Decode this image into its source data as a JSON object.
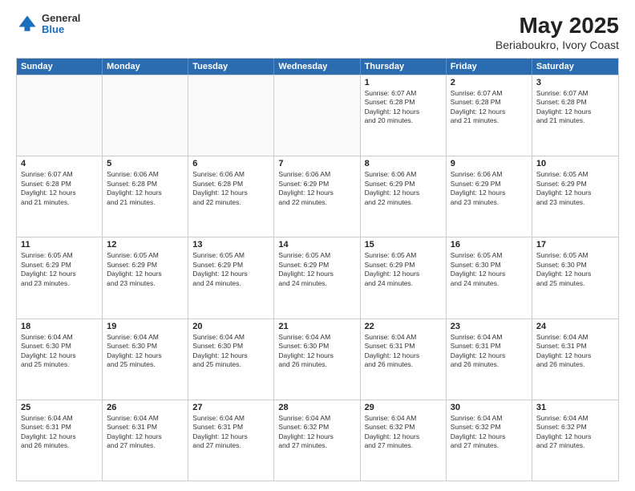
{
  "header": {
    "logo_line1": "General",
    "logo_line2": "Blue",
    "title": "May 2025",
    "subtitle": "Beriaboukro, Ivory Coast"
  },
  "weekdays": [
    "Sunday",
    "Monday",
    "Tuesday",
    "Wednesday",
    "Thursday",
    "Friday",
    "Saturday"
  ],
  "rows": [
    [
      {
        "day": "",
        "text": "",
        "empty": true
      },
      {
        "day": "",
        "text": "",
        "empty": true
      },
      {
        "day": "",
        "text": "",
        "empty": true
      },
      {
        "day": "",
        "text": "",
        "empty": true
      },
      {
        "day": "1",
        "text": "Sunrise: 6:07 AM\nSunset: 6:28 PM\nDaylight: 12 hours\nand 20 minutes.",
        "empty": false
      },
      {
        "day": "2",
        "text": "Sunrise: 6:07 AM\nSunset: 6:28 PM\nDaylight: 12 hours\nand 21 minutes.",
        "empty": false
      },
      {
        "day": "3",
        "text": "Sunrise: 6:07 AM\nSunset: 6:28 PM\nDaylight: 12 hours\nand 21 minutes.",
        "empty": false
      }
    ],
    [
      {
        "day": "4",
        "text": "Sunrise: 6:07 AM\nSunset: 6:28 PM\nDaylight: 12 hours\nand 21 minutes.",
        "empty": false
      },
      {
        "day": "5",
        "text": "Sunrise: 6:06 AM\nSunset: 6:28 PM\nDaylight: 12 hours\nand 21 minutes.",
        "empty": false
      },
      {
        "day": "6",
        "text": "Sunrise: 6:06 AM\nSunset: 6:28 PM\nDaylight: 12 hours\nand 22 minutes.",
        "empty": false
      },
      {
        "day": "7",
        "text": "Sunrise: 6:06 AM\nSunset: 6:29 PM\nDaylight: 12 hours\nand 22 minutes.",
        "empty": false
      },
      {
        "day": "8",
        "text": "Sunrise: 6:06 AM\nSunset: 6:29 PM\nDaylight: 12 hours\nand 22 minutes.",
        "empty": false
      },
      {
        "day": "9",
        "text": "Sunrise: 6:06 AM\nSunset: 6:29 PM\nDaylight: 12 hours\nand 23 minutes.",
        "empty": false
      },
      {
        "day": "10",
        "text": "Sunrise: 6:05 AM\nSunset: 6:29 PM\nDaylight: 12 hours\nand 23 minutes.",
        "empty": false
      }
    ],
    [
      {
        "day": "11",
        "text": "Sunrise: 6:05 AM\nSunset: 6:29 PM\nDaylight: 12 hours\nand 23 minutes.",
        "empty": false
      },
      {
        "day": "12",
        "text": "Sunrise: 6:05 AM\nSunset: 6:29 PM\nDaylight: 12 hours\nand 23 minutes.",
        "empty": false
      },
      {
        "day": "13",
        "text": "Sunrise: 6:05 AM\nSunset: 6:29 PM\nDaylight: 12 hours\nand 24 minutes.",
        "empty": false
      },
      {
        "day": "14",
        "text": "Sunrise: 6:05 AM\nSunset: 6:29 PM\nDaylight: 12 hours\nand 24 minutes.",
        "empty": false
      },
      {
        "day": "15",
        "text": "Sunrise: 6:05 AM\nSunset: 6:29 PM\nDaylight: 12 hours\nand 24 minutes.",
        "empty": false
      },
      {
        "day": "16",
        "text": "Sunrise: 6:05 AM\nSunset: 6:30 PM\nDaylight: 12 hours\nand 24 minutes.",
        "empty": false
      },
      {
        "day": "17",
        "text": "Sunrise: 6:05 AM\nSunset: 6:30 PM\nDaylight: 12 hours\nand 25 minutes.",
        "empty": false
      }
    ],
    [
      {
        "day": "18",
        "text": "Sunrise: 6:04 AM\nSunset: 6:30 PM\nDaylight: 12 hours\nand 25 minutes.",
        "empty": false
      },
      {
        "day": "19",
        "text": "Sunrise: 6:04 AM\nSunset: 6:30 PM\nDaylight: 12 hours\nand 25 minutes.",
        "empty": false
      },
      {
        "day": "20",
        "text": "Sunrise: 6:04 AM\nSunset: 6:30 PM\nDaylight: 12 hours\nand 25 minutes.",
        "empty": false
      },
      {
        "day": "21",
        "text": "Sunrise: 6:04 AM\nSunset: 6:30 PM\nDaylight: 12 hours\nand 26 minutes.",
        "empty": false
      },
      {
        "day": "22",
        "text": "Sunrise: 6:04 AM\nSunset: 6:31 PM\nDaylight: 12 hours\nand 26 minutes.",
        "empty": false
      },
      {
        "day": "23",
        "text": "Sunrise: 6:04 AM\nSunset: 6:31 PM\nDaylight: 12 hours\nand 26 minutes.",
        "empty": false
      },
      {
        "day": "24",
        "text": "Sunrise: 6:04 AM\nSunset: 6:31 PM\nDaylight: 12 hours\nand 26 minutes.",
        "empty": false
      }
    ],
    [
      {
        "day": "25",
        "text": "Sunrise: 6:04 AM\nSunset: 6:31 PM\nDaylight: 12 hours\nand 26 minutes.",
        "empty": false
      },
      {
        "day": "26",
        "text": "Sunrise: 6:04 AM\nSunset: 6:31 PM\nDaylight: 12 hours\nand 27 minutes.",
        "empty": false
      },
      {
        "day": "27",
        "text": "Sunrise: 6:04 AM\nSunset: 6:31 PM\nDaylight: 12 hours\nand 27 minutes.",
        "empty": false
      },
      {
        "day": "28",
        "text": "Sunrise: 6:04 AM\nSunset: 6:32 PM\nDaylight: 12 hours\nand 27 minutes.",
        "empty": false
      },
      {
        "day": "29",
        "text": "Sunrise: 6:04 AM\nSunset: 6:32 PM\nDaylight: 12 hours\nand 27 minutes.",
        "empty": false
      },
      {
        "day": "30",
        "text": "Sunrise: 6:04 AM\nSunset: 6:32 PM\nDaylight: 12 hours\nand 27 minutes.",
        "empty": false
      },
      {
        "day": "31",
        "text": "Sunrise: 6:04 AM\nSunset: 6:32 PM\nDaylight: 12 hours\nand 27 minutes.",
        "empty": false
      }
    ]
  ]
}
